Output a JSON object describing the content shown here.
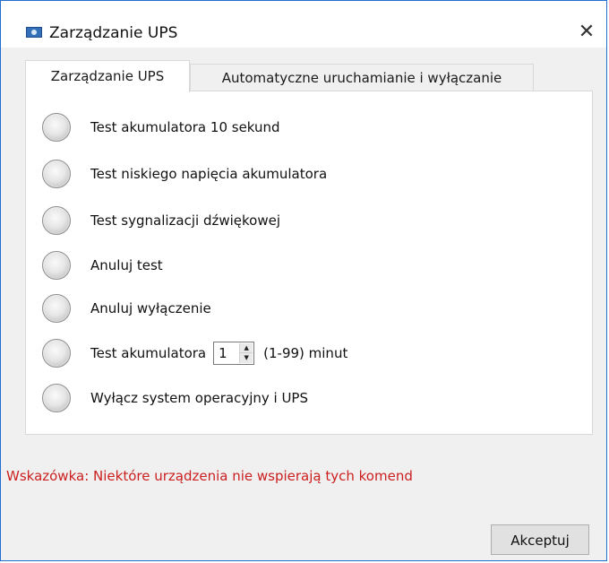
{
  "window": {
    "title": "Zarządzanie UPS",
    "close_symbol": "✕"
  },
  "tabs": [
    {
      "label": "Zarządzanie UPS",
      "active": true
    },
    {
      "label": "Automatyczne uruchamianie i wyłączanie",
      "active": false
    }
  ],
  "options": [
    {
      "label": "Test akumulatora 10 sekund"
    },
    {
      "label": "Test niskiego napięcia akumulatora"
    },
    {
      "label": "Test sygnalizacji dźwiękowej"
    },
    {
      "label": "Anuluj test"
    },
    {
      "label": "Anuluj wyłączenie"
    },
    {
      "label": "Test akumulatora",
      "spinner_value": "1",
      "range_text": "(1-99) minut"
    },
    {
      "label": "Wyłącz system operacyjny i UPS"
    }
  ],
  "hint": "Wskazówka: Niektóre urządzenia nie wspierają tych komend",
  "buttons": {
    "accept_label": "Akceptuj"
  },
  "colors": {
    "window_border": "#1e6fd0",
    "hint_text": "#cc1f1f",
    "dialog_background": "#f0f0f0"
  },
  "icons": {
    "app": "ups-window-icon",
    "close": "close-icon",
    "spinner_up": "spinner-up-icon",
    "spinner_down": "spinner-down-icon"
  }
}
